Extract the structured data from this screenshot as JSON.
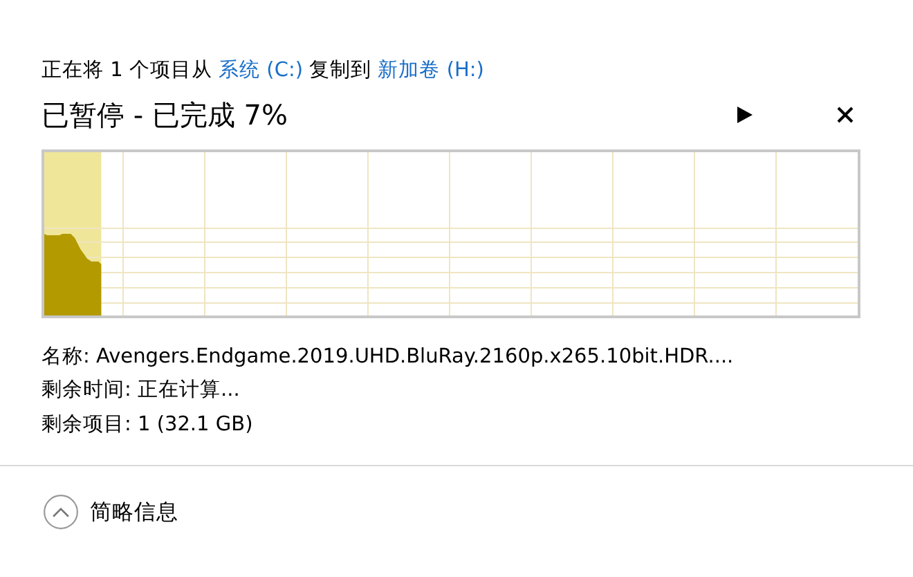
{
  "header": {
    "parts": [
      {
        "kind": "text",
        "text": "正在将 1 个项目从"
      },
      {
        "kind": "link",
        "text": "系统 (C:)"
      },
      {
        "kind": "text",
        "text": "复制到"
      },
      {
        "kind": "link",
        "text": "新加卷 (H:)"
      }
    ]
  },
  "status": "已暂停 - 已完成 7%",
  "paused": true,
  "progress": {
    "level": 0.07
  },
  "details": [
    "名称: Avengers.Endgame.2019.UHD.BluRay.2160p.x265.10bit.HDR....",
    "剩余时间: 正在计算...",
    "剩余项目: 1 (32.1 GB)"
  ],
  "toggle": {
    "label": "简略信息",
    "expanded": true
  }
}
